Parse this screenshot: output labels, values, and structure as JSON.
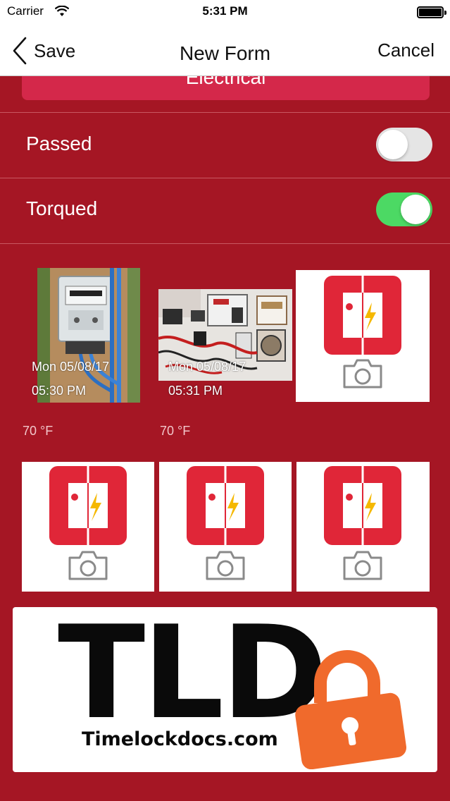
{
  "status_bar": {
    "carrier": "Carrier",
    "time": "5:31 PM"
  },
  "nav": {
    "back_label": "Save",
    "title": "New Form",
    "cancel_label": "Cancel"
  },
  "category_button": {
    "label": "Electrical"
  },
  "toggles": [
    {
      "label": "Passed",
      "on": false
    },
    {
      "label": "Torqued",
      "on": true
    }
  ],
  "photos": [
    {
      "date": "Mon 05/08/17",
      "time": "05:30 PM",
      "temperature": "70 °F"
    },
    {
      "date": "Mon 05/08/17",
      "time": "05:31 PM",
      "temperature": "70 °F"
    }
  ],
  "banner": {
    "letters": "TLD",
    "url": "Timelockdocs.com"
  },
  "colors": {
    "background": "#a51624",
    "accent_red": "#d4284a",
    "switch_on": "#4cd964",
    "lock_orange": "#f06a2c"
  }
}
